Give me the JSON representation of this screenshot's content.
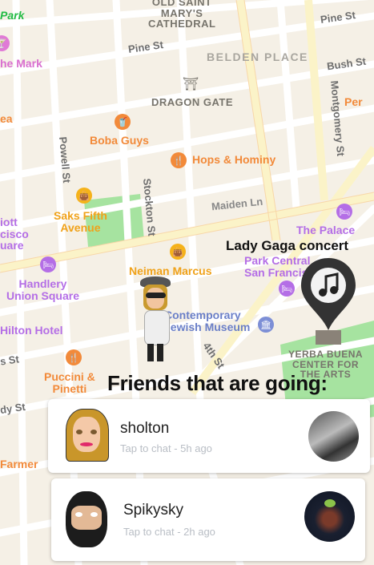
{
  "map": {
    "streets": {
      "pine_1": "Pine St",
      "pine_2": "Pine St",
      "bush": "Bush St",
      "powell": "Powell St",
      "stockton": "Stockton St",
      "montgomery": "Montgomery St",
      "maiden": "Maiden Ln",
      "fourth": "4th St",
      "ellis": "dy St",
      "ofarrell": "s St"
    },
    "places": {
      "park": "Park",
      "old_saint_marys": "OLD SAINT\nMARY'S\nCATHEDRAL",
      "belden_place": "BELDEN PLACE",
      "dragon_gate": "DRAGON GATE",
      "the_mark": "he Mark",
      "tea": "ea",
      "per": "Per",
      "boba_guys": "Boba Guys",
      "hops_hominy": "Hops & Hominy",
      "saks": "Saks Fifth\nAvenue",
      "marriott": "iott\ncisco\nuare",
      "palace": "The Palace",
      "park_central": "Park Central\nSan Francisco",
      "neiman": "Neiman Marcus",
      "handlery": "Handlery\nUnion Square",
      "cjm": "Contemporary\nJewish Museum",
      "hilton": "Hilton Hotel",
      "puccini": "Puccini &\nPinetti",
      "yerba": "YERBA BUENA\nCENTER FOR\nTHE ARTS",
      "farmer": "Farmer"
    }
  },
  "event": {
    "title": "Lady Gaga concert",
    "pin_icon": "music-note-icon"
  },
  "friends_title": "Friends that are going:",
  "friends": [
    {
      "name": "sholton",
      "status": "Tap to chat - 5h ago"
    },
    {
      "name": "Spikysky",
      "status": "Tap to chat - 2h ago"
    }
  ],
  "colors": {
    "map_bg": "#f5f0e6",
    "orange_poi": "#f28a3a",
    "purple_poi": "#b46ee6",
    "pin": "#333333"
  }
}
